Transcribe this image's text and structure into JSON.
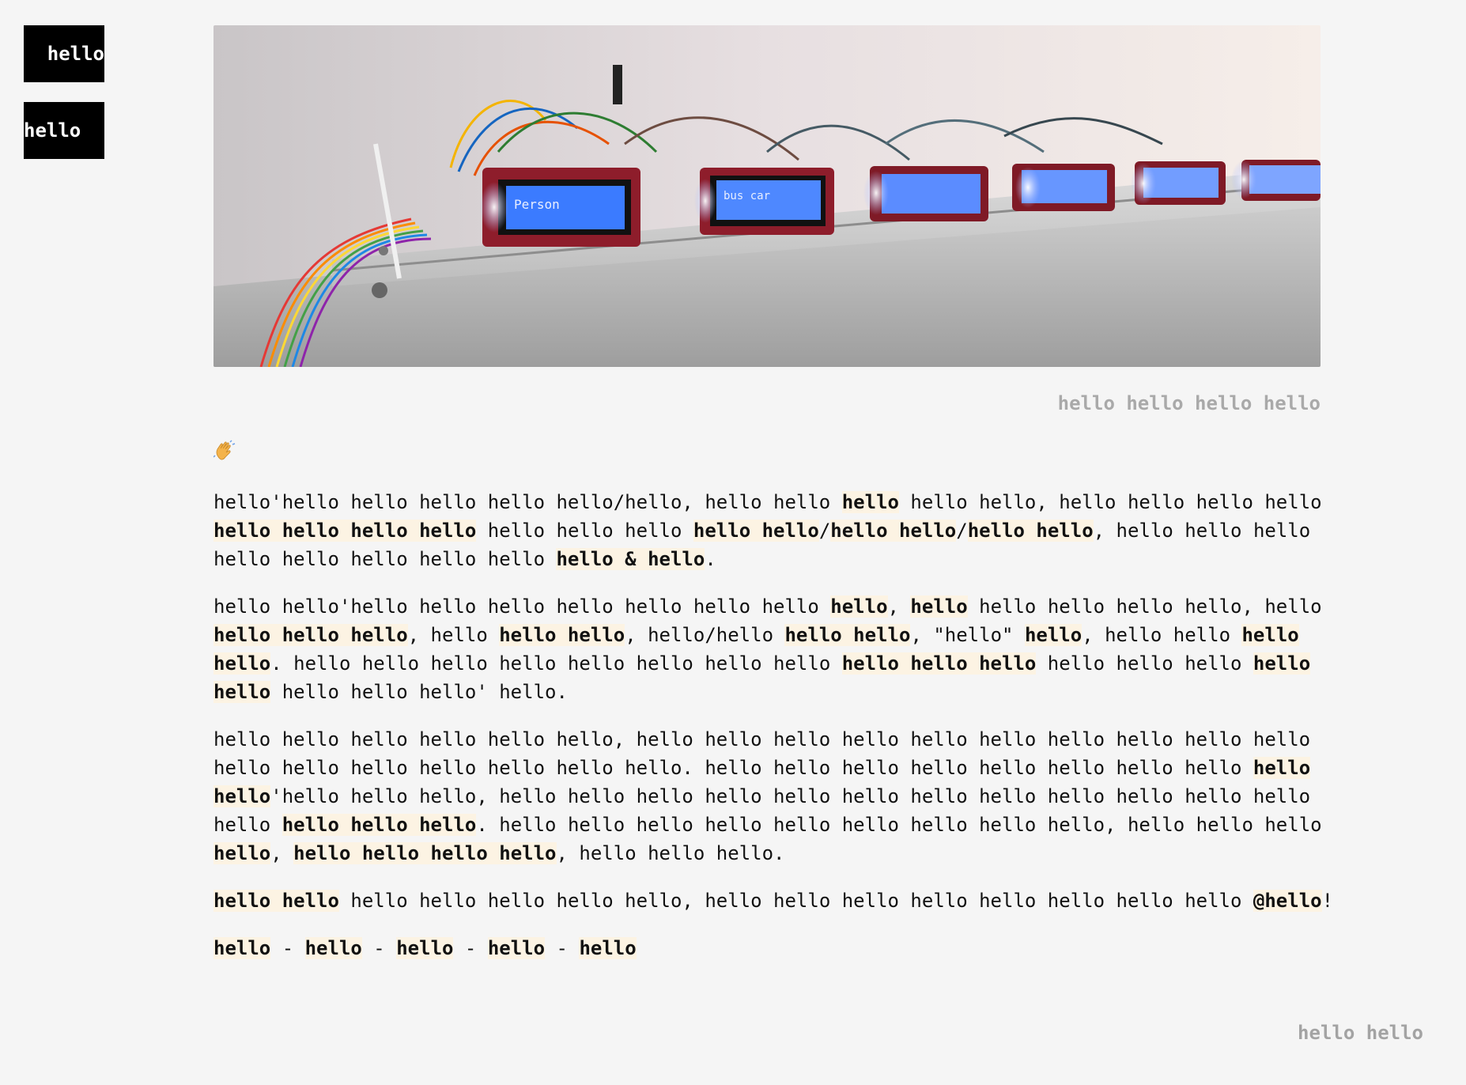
{
  "nav": {
    "button1_label": "hello",
    "button2_label": "hello"
  },
  "hero": {
    "image_alt": "LCD displays wired on a shelf",
    "lcd1_text": "Person",
    "lcd2_text": "bus car"
  },
  "caption": "hello hello hello hello",
  "wave_icon": "waving-hand-icon",
  "paragraphs": [
    {
      "s1": "hello'hello hello hello hello hello/hello, hello hello ",
      "b1": "hello",
      "s2": " hello hello, hello hello hello hello ",
      "b2": "hello hello hello hello",
      "s3": " hello hello hello ",
      "b3": "hello hello",
      "s4": "/",
      "b4": "hello hello",
      "s5": "/",
      "b5": "hello hello",
      "s6": ", hello hello hello hello hello hello hello hello ",
      "b6": "hello & hello",
      "s7": "."
    },
    {
      "s1": "hello hello'hello hello hello hello hello hello hello ",
      "b1": "hello",
      "s2": ", ",
      "b2": "hello",
      "s3": " hello hello hello hello, hello ",
      "b3": "hello hello hello",
      "s4": ", hello ",
      "b4": "hello hello",
      "s5": ", hello/hello ",
      "b5": "hello hello",
      "s6": ", \"hello\" ",
      "b6": "hello",
      "s7": ", hello hello ",
      "b7": "hello hello",
      "s8": ". hello hello hello hello hello hello hello hello ",
      "b8": "hello hello hello",
      "s9": " hello hello hello ",
      "b9": "hello hello",
      "s10": " hello hello hello' hello."
    },
    {
      "s1": "hello hello hello hello hello hello, hello hello hello hello hello hello hello hello hello hello hello hello hello hello hello hello hello. hello hello hello hello hello hello hello hello ",
      "b1": "hello hello",
      "s2": "'hello hello hello, hello hello hello hello hello hello hello hello hello hello hello hello hello ",
      "b2": "hello hello hello",
      "s3": ". hello hello hello hello hello hello hello hello hello, hello hello hello ",
      "b3": "hello",
      "s4": ", ",
      "b4": "hello hello hello hello",
      "s5": ", hello hello hello."
    },
    {
      "b1": "hello hello",
      "s1": " hello hello hello hello hello, hello hello hello hello hello hello hello hello ",
      "b2": "@hello",
      "s2": "!"
    },
    {
      "b1": "hello",
      "s1": " - ",
      "b2": "hello",
      "s2": " - ",
      "b3": "hello",
      "s3": " - ",
      "b4": "hello",
      "s4": " - ",
      "b5": "hello"
    }
  ],
  "footer": "hello hello",
  "colors": {
    "background": "#f5f5f5",
    "button": "#000000",
    "highlight": "#fcf3e3",
    "caption": "#a9a9a9"
  }
}
